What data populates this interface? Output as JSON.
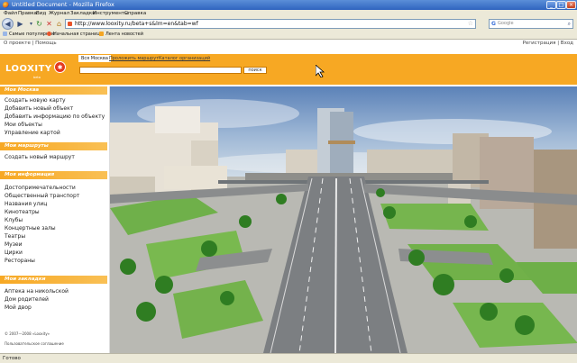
{
  "window": {
    "title": "Untitled Document - Mozilla Firefox"
  },
  "menu": [
    "Файл",
    "Правка",
    "Вид",
    "Журнал",
    "Закладки",
    "Инструменты",
    "Справка"
  ],
  "nav": {
    "url": "http://www.looxity.ru/beta+s&lm=en&tab=wf",
    "search_placeholder": "Google"
  },
  "bookmarks": [
    "Самые популярные",
    "Начальная страница",
    "Лента новостей"
  ],
  "page": {
    "toplinks_left": "О проекте | Помощь",
    "toplinks_right": "Регистрация | Вход",
    "logo": "LOOXITY",
    "logo_sub": "beta",
    "tabs": [
      "Вся Москва",
      "Проложить маршрут",
      "Каталог организаций"
    ],
    "search_button": "поиск"
  },
  "sidebar": {
    "sections": [
      {
        "title": "Моя Москва",
        "links": [
          "Создать новую карту",
          "Добавить новый объект",
          "Добавить информацию по объекту",
          "Мои объекты",
          "Управление картой"
        ]
      },
      {
        "title": "Мои маршруты",
        "links": [
          "Создать новый маршрут"
        ]
      },
      {
        "title": "Моя информация",
        "links": [
          "Достопримечательности",
          "Общественный транспорт",
          "Названия улиц",
          "Кинотеатры",
          "Клубы",
          "Концертные залы",
          "Театры",
          "Музеи",
          "Цирки",
          "Рестораны"
        ]
      },
      {
        "title": "Мои закладки",
        "links": [
          "Аптека на никольской",
          "Дом родителей",
          "Мой двор"
        ]
      }
    ],
    "copyright": "© 2007—2008 «Looxity»",
    "agreement": "Пользовательское соглашение"
  },
  "status": "Готово",
  "colors": {
    "accent": "#f7a823",
    "logo_badge": "#e53a1e"
  }
}
